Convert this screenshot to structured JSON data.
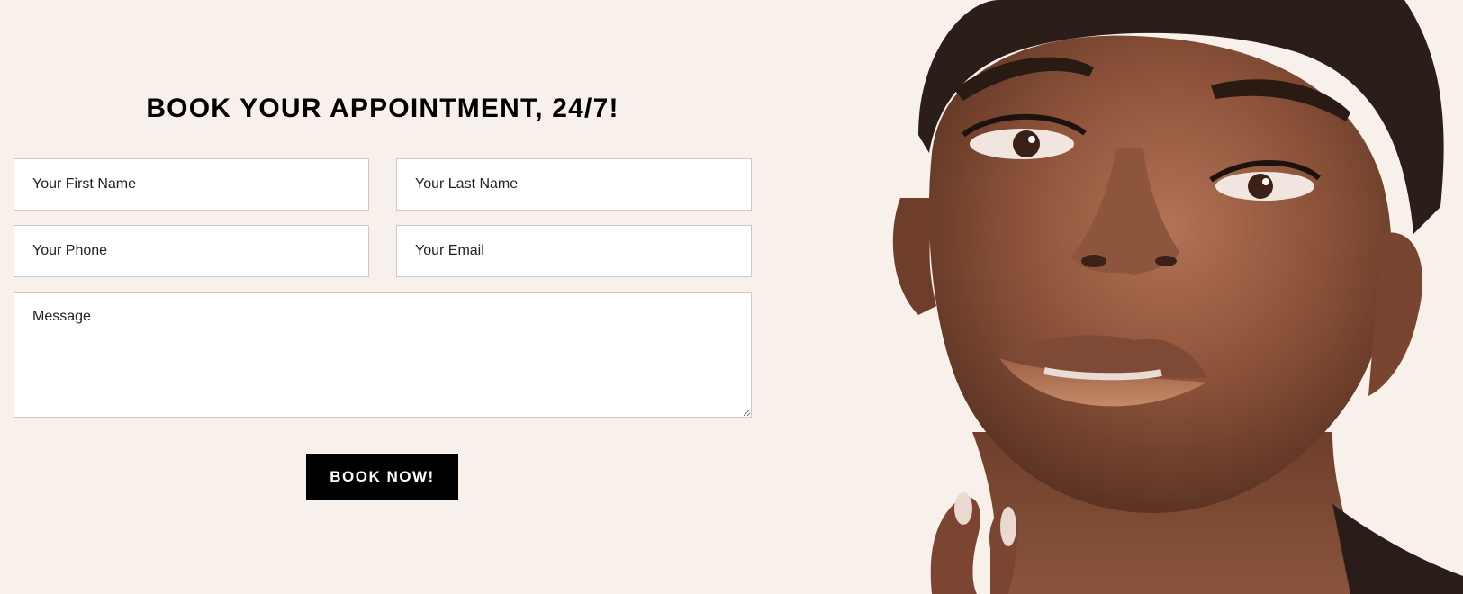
{
  "form": {
    "heading": "BOOK YOUR APPOINTMENT, 24/7!",
    "first_name_placeholder": "Your First Name",
    "last_name_placeholder": "Your Last Name",
    "phone_placeholder": "Your Phone",
    "email_placeholder": "Your Email",
    "message_placeholder": "Message",
    "submit_label": "BOOK NOW!"
  },
  "theme": {
    "background": "#f8f0eb",
    "button_color": "#000000",
    "button_text_color": "#ffffff"
  },
  "image": {
    "subject": "portrait-photo"
  }
}
